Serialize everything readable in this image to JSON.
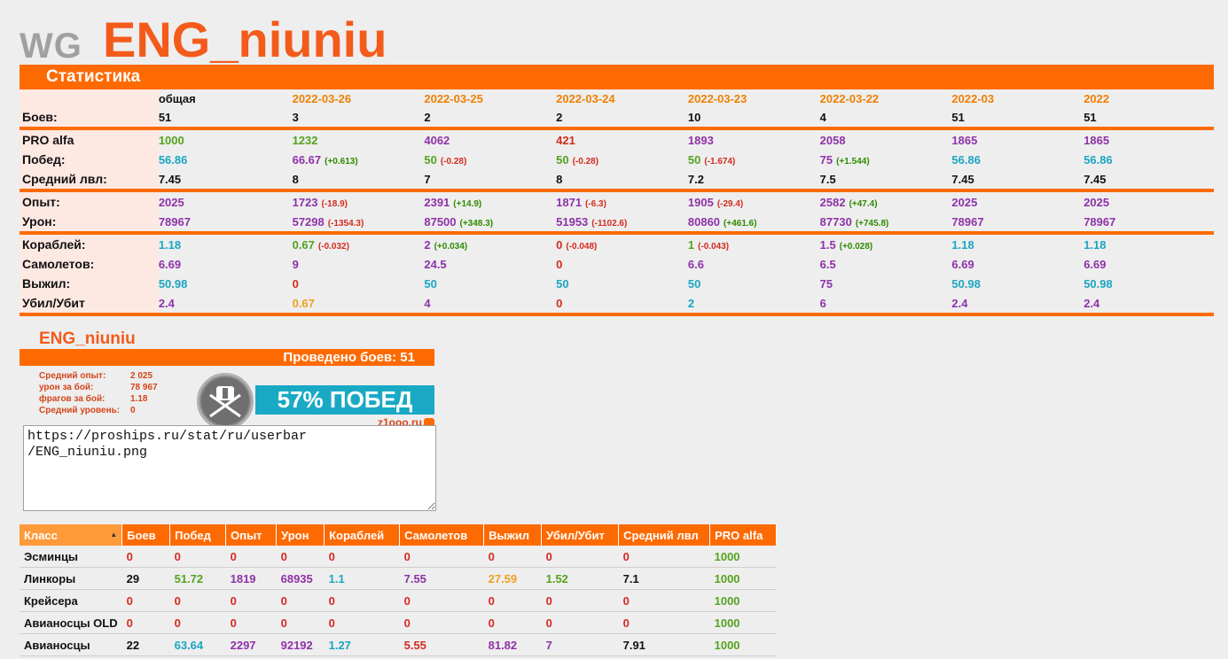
{
  "header": {
    "logo": "WG",
    "nickname": "ENG_niuniu"
  },
  "stats": {
    "title": "Статистика",
    "col_headers": [
      "общая",
      "2022-03-26",
      "2022-03-25",
      "2022-03-24",
      "2022-03-23",
      "2022-03-22",
      "2022-03",
      "2022"
    ],
    "rows": [
      {
        "label": "Боев:",
        "cells": [
          {
            "v": "51",
            "c": "black"
          },
          {
            "v": "3",
            "c": "black"
          },
          {
            "v": "2",
            "c": "black"
          },
          {
            "v": "2",
            "c": "black"
          },
          {
            "v": "10",
            "c": "black"
          },
          {
            "v": "4",
            "c": "black"
          },
          {
            "v": "51",
            "c": "black"
          },
          {
            "v": "51",
            "c": "black"
          }
        ],
        "sep": true
      },
      {
        "label": "PRO alfa",
        "cells": [
          {
            "v": "1000",
            "c": "green"
          },
          {
            "v": "1232",
            "c": "green"
          },
          {
            "v": "4062",
            "c": "purple"
          },
          {
            "v": "421",
            "c": "red"
          },
          {
            "v": "1893",
            "c": "purple"
          },
          {
            "v": "2058",
            "c": "purple"
          },
          {
            "v": "1865",
            "c": "purple"
          },
          {
            "v": "1865",
            "c": "purple"
          }
        ]
      },
      {
        "label": "Побед:",
        "cells": [
          {
            "v": "56.86",
            "c": "teal"
          },
          {
            "v": "66.67",
            "c": "purple",
            "d": "(+0.613)",
            "s": "p"
          },
          {
            "v": "50",
            "c": "green",
            "d": "(-0.28)",
            "s": "n"
          },
          {
            "v": "50",
            "c": "green",
            "d": "(-0.28)",
            "s": "n"
          },
          {
            "v": "50",
            "c": "green",
            "d": "(-1.674)",
            "s": "n"
          },
          {
            "v": "75",
            "c": "purple",
            "d": "(+1.544)",
            "s": "p"
          },
          {
            "v": "56.86",
            "c": "teal"
          },
          {
            "v": "56.86",
            "c": "teal"
          }
        ]
      },
      {
        "label": "Средний лвл:",
        "cells": [
          {
            "v": "7.45",
            "c": "black"
          },
          {
            "v": "8",
            "c": "black"
          },
          {
            "v": "7",
            "c": "black"
          },
          {
            "v": "8",
            "c": "black"
          },
          {
            "v": "7.2",
            "c": "black"
          },
          {
            "v": "7.5",
            "c": "black"
          },
          {
            "v": "7.45",
            "c": "black"
          },
          {
            "v": "7.45",
            "c": "black"
          }
        ],
        "sep": true
      },
      {
        "label": "Опыт:",
        "cells": [
          {
            "v": "2025",
            "c": "purple"
          },
          {
            "v": "1723",
            "c": "purple",
            "d": "(-18.9)",
            "s": "n"
          },
          {
            "v": "2391",
            "c": "purple",
            "d": "(+14.9)",
            "s": "p"
          },
          {
            "v": "1871",
            "c": "purple",
            "d": "(-6.3)",
            "s": "n"
          },
          {
            "v": "1905",
            "c": "purple",
            "d": "(-29.4)",
            "s": "n"
          },
          {
            "v": "2582",
            "c": "purple",
            "d": "(+47.4)",
            "s": "p"
          },
          {
            "v": "2025",
            "c": "purple"
          },
          {
            "v": "2025",
            "c": "purple"
          }
        ]
      },
      {
        "label": "Урон:",
        "cells": [
          {
            "v": "78967",
            "c": "purple"
          },
          {
            "v": "57298",
            "c": "purple",
            "d": "(-1354.3)",
            "s": "n"
          },
          {
            "v": "87500",
            "c": "purple",
            "d": "(+348.3)",
            "s": "p"
          },
          {
            "v": "51953",
            "c": "purple",
            "d": "(-1102.6)",
            "s": "n"
          },
          {
            "v": "80860",
            "c": "purple",
            "d": "(+461.6)",
            "s": "p"
          },
          {
            "v": "87730",
            "c": "purple",
            "d": "(+745.8)",
            "s": "p"
          },
          {
            "v": "78967",
            "c": "purple"
          },
          {
            "v": "78967",
            "c": "purple"
          }
        ],
        "sep": true
      },
      {
        "label": "Кораблей:",
        "cells": [
          {
            "v": "1.18",
            "c": "teal"
          },
          {
            "v": "0.67",
            "c": "green",
            "d": "(-0.032)",
            "s": "n"
          },
          {
            "v": "2",
            "c": "purple",
            "d": "(+0.034)",
            "s": "p"
          },
          {
            "v": "0",
            "c": "red",
            "d": "(-0.048)",
            "s": "n"
          },
          {
            "v": "1",
            "c": "green",
            "d": "(-0.043)",
            "s": "n"
          },
          {
            "v": "1.5",
            "c": "purple",
            "d": "(+0.028)",
            "s": "p"
          },
          {
            "v": "1.18",
            "c": "teal"
          },
          {
            "v": "1.18",
            "c": "teal"
          }
        ]
      },
      {
        "label": "Самолетов:",
        "cells": [
          {
            "v": "6.69",
            "c": "purple"
          },
          {
            "v": "9",
            "c": "purple"
          },
          {
            "v": "24.5",
            "c": "purple"
          },
          {
            "v": "0",
            "c": "red"
          },
          {
            "v": "6.6",
            "c": "purple"
          },
          {
            "v": "6.5",
            "c": "purple"
          },
          {
            "v": "6.69",
            "c": "purple"
          },
          {
            "v": "6.69",
            "c": "purple"
          }
        ]
      },
      {
        "label": "Выжил:",
        "cells": [
          {
            "v": "50.98",
            "c": "teal"
          },
          {
            "v": "0",
            "c": "red"
          },
          {
            "v": "50",
            "c": "teal"
          },
          {
            "v": "50",
            "c": "teal"
          },
          {
            "v": "50",
            "c": "teal"
          },
          {
            "v": "75",
            "c": "purple"
          },
          {
            "v": "50.98",
            "c": "teal"
          },
          {
            "v": "50.98",
            "c": "teal"
          }
        ]
      },
      {
        "label": "Убил/Убит",
        "cells": [
          {
            "v": "2.4",
            "c": "purple"
          },
          {
            "v": "0.67",
            "c": "orange"
          },
          {
            "v": "4",
            "c": "purple"
          },
          {
            "v": "0",
            "c": "red"
          },
          {
            "v": "2",
            "c": "teal"
          },
          {
            "v": "6",
            "c": "purple"
          },
          {
            "v": "2.4",
            "c": "purple"
          },
          {
            "v": "2.4",
            "c": "purple"
          }
        ],
        "sep": true
      }
    ]
  },
  "signature": {
    "name": "ENG_niuniu",
    "battles_text": "Проведено боев: 51",
    "stats": [
      {
        "k": "Средний опыт:",
        "v": "2 025"
      },
      {
        "k": "урон за бой:",
        "v": "78 967"
      },
      {
        "k": "фрагов за бой:",
        "v": "1.18"
      },
      {
        "k": "Средний уровень:",
        "v": "0"
      }
    ],
    "win_text": "57% ПОБЕД",
    "site": "z1ooo.ru"
  },
  "url_box": {
    "value": "https://proships.ru/stat/ru/userbar\n/ENG_niuniu.png"
  },
  "class_table": {
    "headers": [
      "Класс",
      "Боев",
      "Побед",
      "Опыт",
      "Урон",
      "Кораблей",
      "Самолетов",
      "Выжил",
      "Убил/Убит",
      "Средний лвл",
      "PRO alfa"
    ],
    "sort_icon": "sort-up-icon",
    "rows": [
      {
        "cells": [
          {
            "v": "Эсминцы",
            "c": "black"
          },
          {
            "v": "0",
            "c": "red"
          },
          {
            "v": "0",
            "c": "red"
          },
          {
            "v": "0",
            "c": "red"
          },
          {
            "v": "0",
            "c": "red"
          },
          {
            "v": "0",
            "c": "red"
          },
          {
            "v": "0",
            "c": "red"
          },
          {
            "v": "0",
            "c": "red"
          },
          {
            "v": "0",
            "c": "red"
          },
          {
            "v": "0",
            "c": "red"
          },
          {
            "v": "1000",
            "c": "green"
          }
        ]
      },
      {
        "cells": [
          {
            "v": "Линкоры",
            "c": "black"
          },
          {
            "v": "29",
            "c": "black"
          },
          {
            "v": "51.72",
            "c": "green"
          },
          {
            "v": "1819",
            "c": "purple"
          },
          {
            "v": "68935",
            "c": "purple"
          },
          {
            "v": "1.1",
            "c": "teal"
          },
          {
            "v": "7.55",
            "c": "purple"
          },
          {
            "v": "27.59",
            "c": "orange"
          },
          {
            "v": "1.52",
            "c": "green"
          },
          {
            "v": "7.1",
            "c": "black"
          },
          {
            "v": "1000",
            "c": "green"
          }
        ]
      },
      {
        "cells": [
          {
            "v": "Крейсера",
            "c": "black"
          },
          {
            "v": "0",
            "c": "red"
          },
          {
            "v": "0",
            "c": "red"
          },
          {
            "v": "0",
            "c": "red"
          },
          {
            "v": "0",
            "c": "red"
          },
          {
            "v": "0",
            "c": "red"
          },
          {
            "v": "0",
            "c": "red"
          },
          {
            "v": "0",
            "c": "red"
          },
          {
            "v": "0",
            "c": "red"
          },
          {
            "v": "0",
            "c": "red"
          },
          {
            "v": "1000",
            "c": "green"
          }
        ]
      },
      {
        "cells": [
          {
            "v": "Авианосцы OLD",
            "c": "black"
          },
          {
            "v": "0",
            "c": "red"
          },
          {
            "v": "0",
            "c": "red"
          },
          {
            "v": "0",
            "c": "red"
          },
          {
            "v": "0",
            "c": "red"
          },
          {
            "v": "0",
            "c": "red"
          },
          {
            "v": "0",
            "c": "red"
          },
          {
            "v": "0",
            "c": "red"
          },
          {
            "v": "0",
            "c": "red"
          },
          {
            "v": "0",
            "c": "red"
          },
          {
            "v": "1000",
            "c": "green"
          }
        ]
      },
      {
        "cells": [
          {
            "v": "Авианосцы",
            "c": "black"
          },
          {
            "v": "22",
            "c": "black"
          },
          {
            "v": "63.64",
            "c": "teal"
          },
          {
            "v": "2297",
            "c": "purple"
          },
          {
            "v": "92192",
            "c": "purple"
          },
          {
            "v": "1.27",
            "c": "teal"
          },
          {
            "v": "5.55",
            "c": "red"
          },
          {
            "v": "81.82",
            "c": "purple"
          },
          {
            "v": "7",
            "c": "purple"
          },
          {
            "v": "7.91",
            "c": "black"
          },
          {
            "v": "1000",
            "c": "green"
          }
        ]
      }
    ]
  }
}
